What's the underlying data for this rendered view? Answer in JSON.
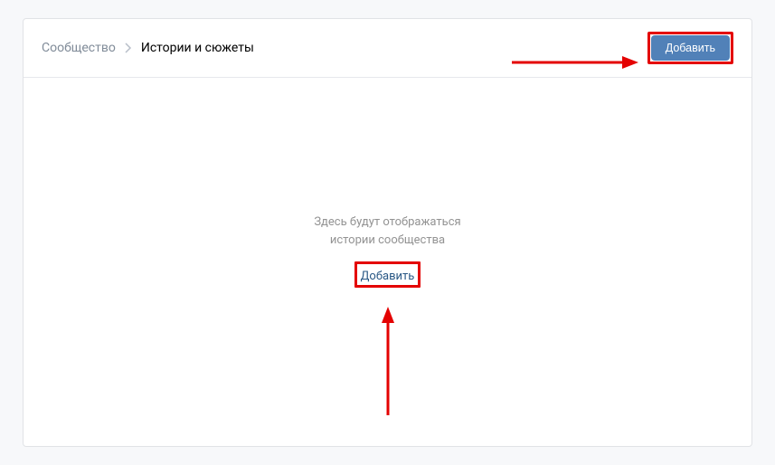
{
  "breadcrumb": {
    "parent": "Сообщество",
    "current": "Истории и сюжеты"
  },
  "header": {
    "add_button": "Добавить"
  },
  "empty_state": {
    "line1": "Здесь будут отображаться",
    "line2": "истории сообщества",
    "add_link": "Добавить"
  }
}
